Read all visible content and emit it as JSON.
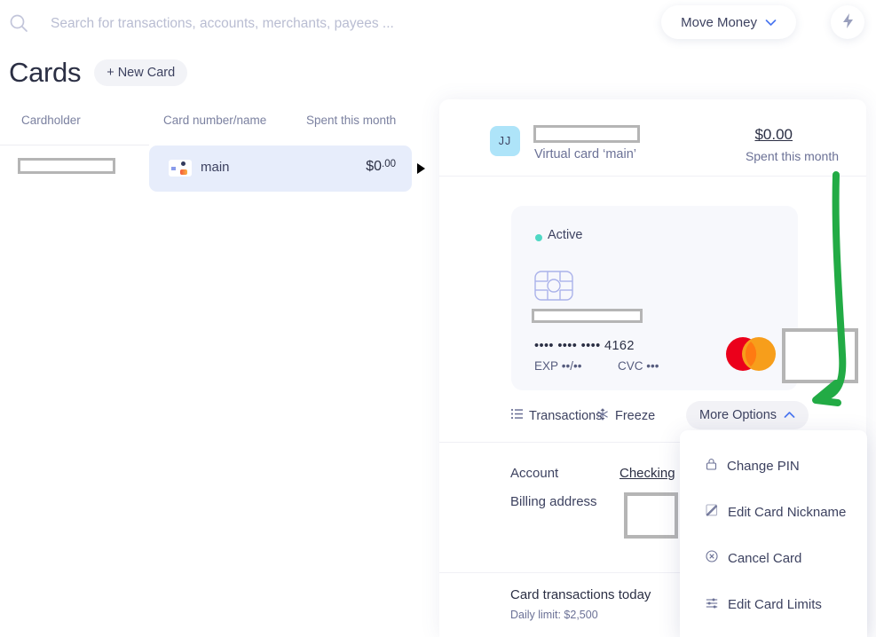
{
  "search": {
    "placeholder": "Search for transactions, accounts, merchants, payees ...",
    "value": "",
    "icon": "search-icon"
  },
  "topbar": {
    "move_money_label": "Move Money",
    "move_money_chevron": "chevron-down-icon",
    "bolt_icon": "lightning-bolt-icon"
  },
  "page": {
    "title": "Cards",
    "new_card_label": "+ New Card"
  },
  "card_list": {
    "columns": [
      "Cardholder",
      "Card number/name",
      "Spent this month"
    ],
    "rows": [
      {
        "cardholder": "",
        "cardholder_redacted": true,
        "name": "main",
        "spent_dollars": "$0",
        "spent_cents": ".00",
        "selected": true
      }
    ]
  },
  "detail": {
    "avatar_initials": "JJ",
    "cardholder_name_redacted": true,
    "subtitle": "Virtual card ‘main’",
    "spent_amount": "$0.00",
    "spent_label": "Spent this month",
    "card": {
      "status": "Active",
      "status_color": "#4fd8c4",
      "chip_icon": "emv-chip-icon",
      "nickname_redacted": true,
      "number": "•••• •••• •••• 4162",
      "last4": "4162",
      "exp_label": "EXP",
      "exp_value": "••/••",
      "cvc_label": "CVC",
      "cvc_value": "•••",
      "network": "mastercard",
      "network_colors": {
        "left": "#eb001b",
        "right": "#f79e1b",
        "overlap": "#ff5f00"
      }
    },
    "actions": [
      {
        "label": "Transactions",
        "icon": "list-icon"
      },
      {
        "label": "Freeze",
        "icon": "snowflake-icon"
      },
      {
        "label": "More Options",
        "icon": "chevron-up-icon",
        "active": true
      }
    ],
    "fields": [
      {
        "label": "Account",
        "value": "Checking",
        "link": true
      },
      {
        "label": "Billing address",
        "value": "",
        "redacted": true
      }
    ],
    "transactions": {
      "title": "Card transactions today",
      "daily_limit": "Daily limit: $2,500"
    }
  },
  "dropdown": {
    "items": [
      {
        "label": "Change PIN",
        "icon": "lock-icon"
      },
      {
        "label": "Edit Card Nickname",
        "icon": "edit-pencil-icon"
      },
      {
        "label": "Cancel Card",
        "icon": "circle-x-icon"
      },
      {
        "label": "Edit Card Limits",
        "icon": "sliders-icon"
      }
    ]
  },
  "annotation": {
    "type": "curved-arrow",
    "color": "#22ab45",
    "points_to": "More Options"
  }
}
